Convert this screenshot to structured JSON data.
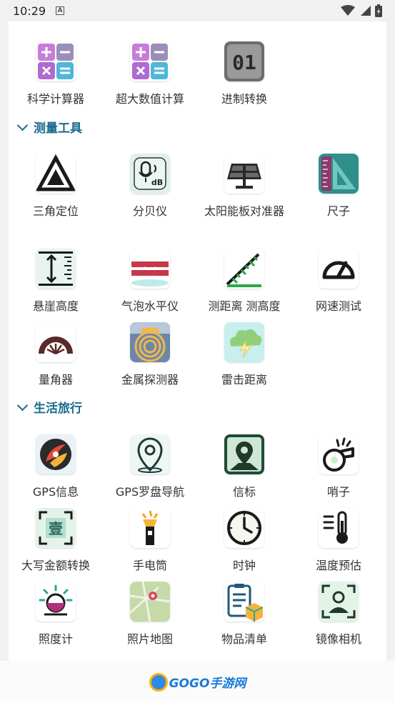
{
  "status_bar": {
    "time": "10:29",
    "notif_letter": "A"
  },
  "sections": [
    {
      "title": "测量工具"
    },
    {
      "title": "生活旅行"
    }
  ],
  "top_row": [
    {
      "label": "科学计算器",
      "icon": "calculator-icon"
    },
    {
      "label": "超大数值计算",
      "icon": "big-calculator-icon"
    },
    {
      "label": "进制转换",
      "icon": "base-convert-icon"
    }
  ],
  "measure_tools": [
    {
      "label": "三角定位",
      "icon": "triangle-icon"
    },
    {
      "label": "分贝仪",
      "icon": "decibel-icon"
    },
    {
      "label": "太阳能板对准器",
      "icon": "solar-panel-icon"
    },
    {
      "label": "尺子",
      "icon": "ruler-icon"
    },
    {
      "label": "悬崖高度",
      "icon": "cliff-height-icon"
    },
    {
      "label": "气泡水平仪",
      "icon": "bubble-level-icon"
    },
    {
      "label": "测距离 测高度",
      "icon": "distance-height-icon"
    },
    {
      "label": "网速测试",
      "icon": "speedometer-icon"
    },
    {
      "label": "量角器",
      "icon": "protractor-icon"
    },
    {
      "label": "金属探测器",
      "icon": "metal-detector-icon"
    },
    {
      "label": "雷击距离",
      "icon": "lightning-icon"
    }
  ],
  "life_tools": [
    {
      "label": "GPS信息",
      "icon": "gps-info-icon"
    },
    {
      "label": "GPS罗盘导航",
      "icon": "gps-compass-icon"
    },
    {
      "label": "信标",
      "icon": "beacon-icon"
    },
    {
      "label": "哨子",
      "icon": "whistle-icon"
    },
    {
      "label": "大写金额转换",
      "icon": "capital-amount-icon"
    },
    {
      "label": "手电筒",
      "icon": "flashlight-icon"
    },
    {
      "label": "时钟",
      "icon": "clock-icon"
    },
    {
      "label": "温度预估",
      "icon": "thermometer-icon"
    },
    {
      "label": "照度计",
      "icon": "lux-meter-icon"
    },
    {
      "label": "照片地图",
      "icon": "photo-map-icon"
    },
    {
      "label": "物品清单",
      "icon": "checklist-icon"
    },
    {
      "label": "镜像相机",
      "icon": "mirror-camera-icon"
    }
  ],
  "footer": {
    "logo_text": "GOGO手游网"
  },
  "colors": {
    "section": "#1a6b8f",
    "accent_teal": "#2aa89a"
  }
}
